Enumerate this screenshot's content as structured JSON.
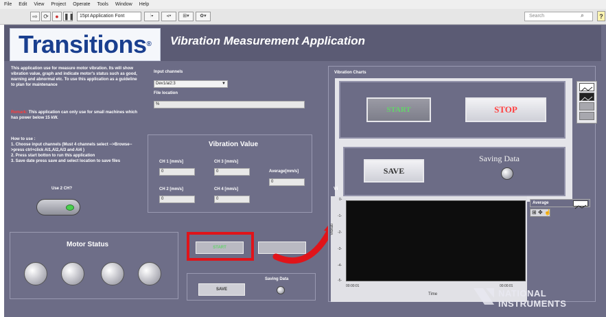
{
  "menubar": {
    "items": [
      "File",
      "Edit",
      "View",
      "Project",
      "Operate",
      "Tools",
      "Window",
      "Help"
    ]
  },
  "toolbar": {
    "font": "15pt Application Font",
    "search_placeholder": "Search"
  },
  "banner": {
    "logo_text": "Transitions",
    "logo_mark": "®",
    "app_title": "Vibration Measurement  Application"
  },
  "intro": {
    "description": "This application use for measure motor vibration. Its will show vibration value, graph and indicate motor's status such as good, warning and abnormal etc. To use this application as a guideline to plan for maintenance",
    "remark_label": "Remark:",
    "remark": "This application can only use for small machines which has power below 15 kW.",
    "howto": "How to use :\n1. Choose input channels (Must 4 channels select -->Browse-->press ctrl+click AI1,AI2,AI3 and AI4 )\n2. Press start botton to run this application\n3. Save date press save and select location to save files"
  },
  "input": {
    "channels_label": "Input channels",
    "channels_value": "Dev1/ai2:3",
    "file_label": "File location",
    "file_value": "%"
  },
  "use2ch": {
    "label": "Use 2 CH?"
  },
  "vibration": {
    "title": "Vibration Value",
    "ch1_label": "CH 1 [mm/s]",
    "ch1_value": "0",
    "ch2_label": "CH 2 [mm/s]",
    "ch2_value": "0",
    "ch3_label": "CH 3 [mm/s]",
    "ch3_value": "0",
    "ch4_label": "CH 4 [mm/s]",
    "ch4_value": "0",
    "avg_label": "Average[mm/s]",
    "avg_value": "0"
  },
  "motor": {
    "title": "Motor Status"
  },
  "left_controls": {
    "start": "START",
    "save": "SAVE",
    "saving_label": "Saving Data"
  },
  "charts": {
    "title": "Vibration Charts",
    "short_label": "Vi"
  },
  "zoom": {
    "start": "START",
    "stop": "STOP",
    "save": "SAVE",
    "saving_label": "Saving Data"
  },
  "graph": {
    "ylabel": "Vibrati",
    "yticks": [
      "0-",
      "-1-",
      "-2-",
      "-3-",
      "-4-",
      "-5-"
    ],
    "xstart": "00:00:01",
    "xend": "00:00:01",
    "xlabel": "Time",
    "legend_label": "Average"
  },
  "watermark": {
    "line1": "NATIONAL",
    "line2": "INSTRUMENTS"
  },
  "colors": {
    "panel": "#6c6c86",
    "highlight": "#e0141a",
    "start_green": "#64d26a",
    "stop_red": "#ff4040",
    "logo_blue": "#1a3f8f"
  }
}
